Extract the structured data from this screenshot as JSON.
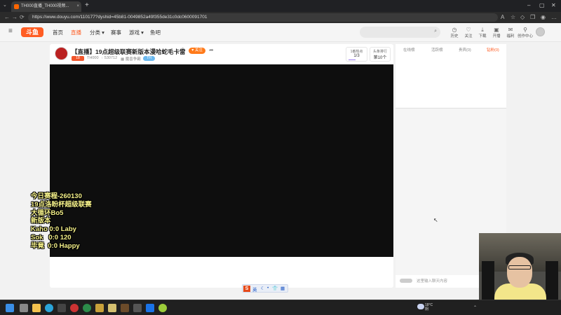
{
  "browser": {
    "tab_title": "TH000直播_TH000视频...",
    "new_tab": "+",
    "url": "https://www.douyu.com/110177?dyshid=45b81-0049852a49f355de31c0dc0600091701"
  },
  "site": {
    "logo": "斗鱼",
    "nav": [
      "首页",
      "直播",
      "分类",
      "赛事",
      "游戏",
      "鱼吧"
    ],
    "header_icons": [
      "历史",
      "关注",
      "下载",
      "开播",
      "福利",
      "创作中心"
    ]
  },
  "room": {
    "title": "【直播】19点超级联赛新版本漫哈蛇毛卡雷",
    "follow_label": "关注",
    "level": "18",
    "anchor_name": "TH000",
    "room_id": "530712",
    "category": "魔兽争霸",
    "tag": "TH",
    "rank_label": "1番热点",
    "rank_value": "1/3",
    "fan_label": "头条排行",
    "fan_value": "第10个"
  },
  "chat": {
    "tabs": [
      "在线榜",
      "活跃榜",
      "贵宾(0)",
      "钻粉(0)"
    ],
    "input_placeholder": "这里输入聊天内容"
  },
  "overlay": {
    "lines": [
      "今日赛程-260130",
      "19点洛盼杯超级联赛",
      "大循环Bo5",
      "新版本",
      "Kaho 0:0 Laby",
      "Sok   0:0 120",
      "毕竟  0:0 Happy"
    ]
  },
  "floatbar": {
    "ime_brand": "S",
    "ime_lang": "英"
  },
  "taskbar": {
    "weather_temp": "18°C",
    "weather_desc": "阴"
  },
  "colors": {
    "accent": "#ff5d23",
    "follow": "#ff7a1a",
    "overlay_text": "#f6f28a",
    "player_bg": "#0e0e0e"
  }
}
